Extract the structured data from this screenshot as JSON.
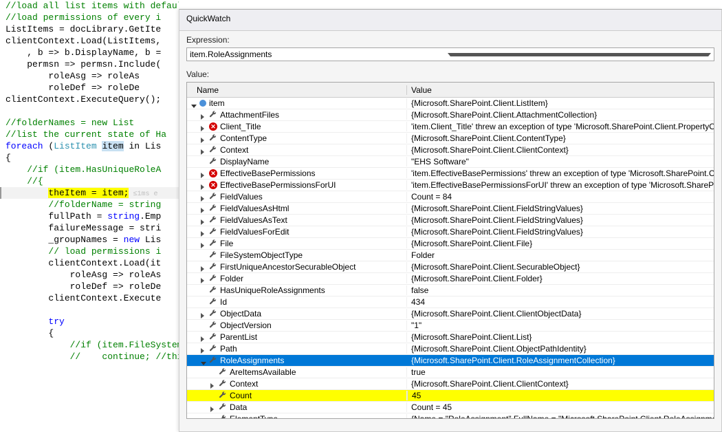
{
  "code": {
    "lines": [
      {
        "indent": 0,
        "cls": "comment",
        "text": "//load all list items with default properties and HasUniqueRoleAssignments property and also"
      },
      {
        "indent": 0,
        "cls": "comment",
        "text": "//load permissions of every i"
      },
      {
        "indent": 0,
        "cls": "plain",
        "text": "ListItems = docLibrary.GetIte"
      },
      {
        "indent": 0,
        "cls": "plain",
        "text": "clientContext.Load(ListItems,"
      },
      {
        "indent": 1,
        "cls": "plain",
        "text": ", b => b.DisplayName, b ="
      },
      {
        "indent": 1,
        "cls": "plain",
        "text": "permsn => permsn.Include("
      },
      {
        "indent": 2,
        "cls": "plain",
        "text": "roleAsg => roleAs"
      },
      {
        "indent": 2,
        "cls": "plain",
        "text": "roleDef => roleDe"
      },
      {
        "indent": 0,
        "cls": "plain",
        "text": "clientContext.ExecuteQuery();"
      },
      {
        "indent": 0,
        "cls": "plain",
        "text": ""
      },
      {
        "indent": 0,
        "cls": "comment",
        "text": "//folderNames = new List<stri"
      },
      {
        "indent": 0,
        "cls": "comment",
        "text": "//list the current state of Ha"
      },
      {
        "indent": 0,
        "cls": "foreach",
        "text": ""
      },
      {
        "indent": 0,
        "cls": "plain",
        "text": "{"
      },
      {
        "indent": 1,
        "cls": "comment",
        "text": "//if (item.HasUniqueRoleA"
      },
      {
        "indent": 1,
        "cls": "comment",
        "text": "//{"
      },
      {
        "indent": 2,
        "cls": "theitem",
        "text": ""
      },
      {
        "indent": 2,
        "cls": "comment",
        "text": "//folderName = string"
      },
      {
        "indent": 2,
        "cls": "mixed",
        "pre": "fullPath = ",
        "key": "string",
        "post": ".Emp"
      },
      {
        "indent": 2,
        "cls": "plain",
        "text": "failureMessage = stri"
      },
      {
        "indent": 2,
        "cls": "mixed",
        "pre": "_groupNames = ",
        "key": "new",
        "post": " Lis",
        "type": "Lis"
      },
      {
        "indent": 2,
        "cls": "comment",
        "text": "// load permissions i"
      },
      {
        "indent": 2,
        "cls": "plain",
        "text": "clientContext.Load(it"
      },
      {
        "indent": 3,
        "cls": "plain",
        "text": "roleAsg => roleAs"
      },
      {
        "indent": 3,
        "cls": "plain",
        "text": "roleDef => roleDe"
      },
      {
        "indent": 2,
        "cls": "plain",
        "text": "clientContext.Execute"
      },
      {
        "indent": 0,
        "cls": "plain",
        "text": ""
      },
      {
        "indent": 2,
        "cls": "keyword",
        "text": "try"
      },
      {
        "indent": 2,
        "cls": "plain",
        "text": "{"
      },
      {
        "indent": 3,
        "cls": "comment",
        "text": "//if (item.FileSystem"
      },
      {
        "indent": 3,
        "cls": "contline",
        "text": ""
      }
    ],
    "foreach_kw": "foreach",
    "foreach_rest1": " (",
    "foreach_type": "ListItem",
    "foreach_var": "item",
    "foreach_rest2": " in Lis",
    "theitem_line": "theItem = item;",
    "theitem_hint": " ≤1ms e",
    "contline_pre": "//    ",
    "contline_kw": "continue",
    "contline_post": "; //thi"
  },
  "quickwatch": {
    "title": "QuickWatch",
    "expr_label": "Expression:",
    "expr_value": "item.RoleAssignments",
    "value_label": "Value:",
    "col_name": "Name",
    "col_value": "Value",
    "rows": [
      {
        "depth": 0,
        "exp": "expanded",
        "icon": "obj",
        "name": "item",
        "value": "{Microsoft.SharePoint.Client.ListItem}"
      },
      {
        "depth": 1,
        "exp": "collapsed",
        "icon": "wrench",
        "name": "AttachmentFiles",
        "value": "{Microsoft.SharePoint.Client.AttachmentCollection}"
      },
      {
        "depth": 1,
        "exp": "collapsed",
        "icon": "err",
        "name": "Client_Title",
        "value": "'item.Client_Title' threw an exception of type 'Microsoft.SharePoint.Client.PropertyOrFie"
      },
      {
        "depth": 1,
        "exp": "collapsed",
        "icon": "wrench",
        "name": "ContentType",
        "value": "{Microsoft.SharePoint.Client.ContentType}"
      },
      {
        "depth": 1,
        "exp": "collapsed",
        "icon": "wrench",
        "name": "Context",
        "value": "{Microsoft.SharePoint.Client.ClientContext}"
      },
      {
        "depth": 1,
        "exp": "none",
        "icon": "wrench",
        "name": "DisplayName",
        "value": "\"EHS Software\""
      },
      {
        "depth": 1,
        "exp": "collapsed",
        "icon": "err",
        "name": "EffectiveBasePermissions",
        "value": "'item.EffectiveBasePermissions' threw an exception of type 'Microsoft.SharePoint.Client"
      },
      {
        "depth": 1,
        "exp": "collapsed",
        "icon": "err",
        "name": "EffectiveBasePermissionsForUI",
        "value": "'item.EffectiveBasePermissionsForUI' threw an exception of type 'Microsoft.SharePoint.C"
      },
      {
        "depth": 1,
        "exp": "collapsed",
        "icon": "wrench",
        "name": "FieldValues",
        "value": "Count = 84"
      },
      {
        "depth": 1,
        "exp": "collapsed",
        "icon": "wrench",
        "name": "FieldValuesAsHtml",
        "value": "{Microsoft.SharePoint.Client.FieldStringValues}"
      },
      {
        "depth": 1,
        "exp": "collapsed",
        "icon": "wrench",
        "name": "FieldValuesAsText",
        "value": "{Microsoft.SharePoint.Client.FieldStringValues}"
      },
      {
        "depth": 1,
        "exp": "collapsed",
        "icon": "wrench",
        "name": "FieldValuesForEdit",
        "value": "{Microsoft.SharePoint.Client.FieldStringValues}"
      },
      {
        "depth": 1,
        "exp": "collapsed",
        "icon": "wrench",
        "name": "File",
        "value": "{Microsoft.SharePoint.Client.File}"
      },
      {
        "depth": 1,
        "exp": "none",
        "icon": "wrench",
        "name": "FileSystemObjectType",
        "value": "Folder"
      },
      {
        "depth": 1,
        "exp": "collapsed",
        "icon": "wrench",
        "name": "FirstUniqueAncestorSecurableObject",
        "value": "{Microsoft.SharePoint.Client.SecurableObject}"
      },
      {
        "depth": 1,
        "exp": "collapsed",
        "icon": "wrench",
        "name": "Folder",
        "value": "{Microsoft.SharePoint.Client.Folder}"
      },
      {
        "depth": 1,
        "exp": "none",
        "icon": "wrench",
        "name": "HasUniqueRoleAssignments",
        "value": "false"
      },
      {
        "depth": 1,
        "exp": "none",
        "icon": "wrench",
        "name": "Id",
        "value": "434"
      },
      {
        "depth": 1,
        "exp": "collapsed",
        "icon": "wrench",
        "name": "ObjectData",
        "value": "{Microsoft.SharePoint.Client.ClientObjectData}"
      },
      {
        "depth": 1,
        "exp": "none",
        "icon": "wrench",
        "name": "ObjectVersion",
        "value": "\"1\""
      },
      {
        "depth": 1,
        "exp": "collapsed",
        "icon": "wrench",
        "name": "ParentList",
        "value": "{Microsoft.SharePoint.Client.List}"
      },
      {
        "depth": 1,
        "exp": "collapsed",
        "icon": "wrench",
        "name": "Path",
        "value": "{Microsoft.SharePoint.Client.ObjectPathIdentity}"
      },
      {
        "depth": 1,
        "exp": "expanded",
        "icon": "wrench",
        "name": "RoleAssignments",
        "value": "{Microsoft.SharePoint.Client.RoleAssignmentCollection}",
        "selected": true
      },
      {
        "depth": 2,
        "exp": "none",
        "icon": "wrench",
        "name": "AreItemsAvailable",
        "value": "true"
      },
      {
        "depth": 2,
        "exp": "collapsed",
        "icon": "wrench",
        "name": "Context",
        "value": "{Microsoft.SharePoint.Client.ClientContext}"
      },
      {
        "depth": 2,
        "exp": "none",
        "icon": "wrench",
        "name": "Count",
        "value": "45",
        "highlight": true
      },
      {
        "depth": 2,
        "exp": "collapsed",
        "icon": "wrench",
        "name": "Data",
        "value": "Count = 45"
      },
      {
        "depth": 2,
        "exp": "none",
        "icon": "wrench",
        "name": "ElementType",
        "value": "{Name = \"RoleAssignment\" FullName = \"Microsoft.SharePoint.Client.RoleAssignment\"}"
      }
    ]
  }
}
